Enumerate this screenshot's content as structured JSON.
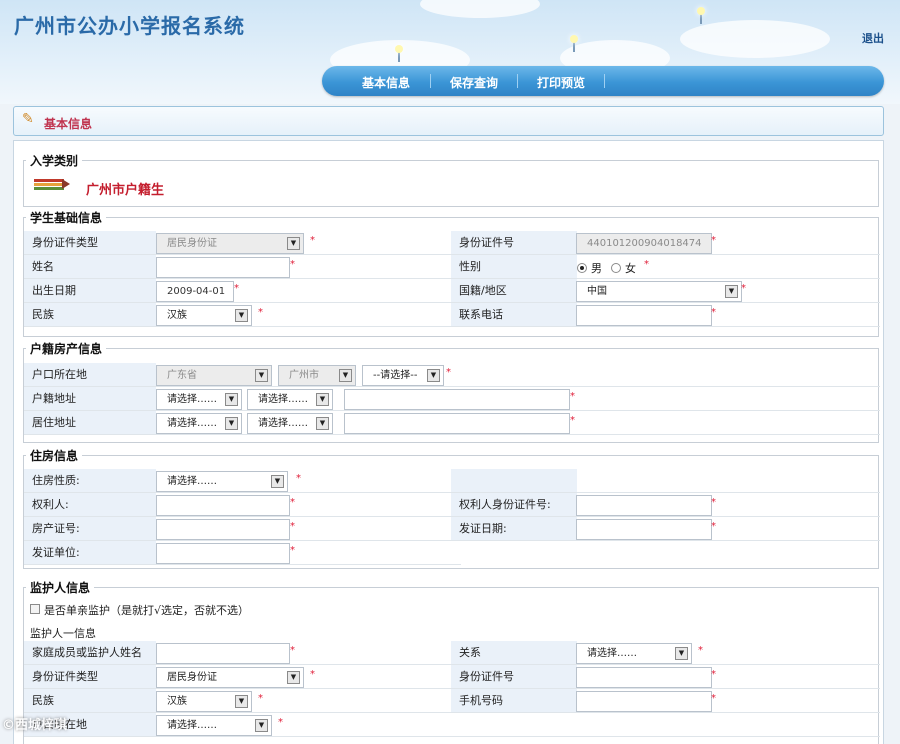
{
  "header": {
    "title": "广州市公办小学报名系统",
    "logout_label": "退出"
  },
  "nav": {
    "items": [
      "基本信息",
      "保存查询",
      "打印预览"
    ]
  },
  "section_bar": {
    "label": "基本信息"
  },
  "enroll_type": {
    "legend": "入学类别",
    "value": "广州市户籍生"
  },
  "student": {
    "legend": "学生基础信息",
    "id_type_label": "身份证件类型",
    "id_type_value": "居民身份证",
    "id_no_label": "身份证件号",
    "id_no_value": "440101200904018474",
    "name_label": "姓名",
    "gender_label": "性别",
    "gender_male": "男",
    "gender_female": "女",
    "birth_label": "出生日期",
    "birth_value": "2009-04-01",
    "nation_label": "国籍/地区",
    "nation_value": "中国",
    "ethnic_label": "民族",
    "ethnic_value": "汉族",
    "phone_label": "联系电话"
  },
  "hukou": {
    "legend": "户籍房产信息",
    "location_label": "户口所在地",
    "province": "广东省",
    "city": "广州市",
    "district": "--请选择--",
    "hukou_addr_label": "户籍地址",
    "residence_addr_label": "居住地址",
    "select_placeholder": "请选择……"
  },
  "housing": {
    "legend": "住房信息",
    "nature_label": "住房性质:",
    "nature_value": "请选择……",
    "owner_label": "权利人:",
    "owner_id_label": "权利人身份证件号:",
    "cert_no_label": "房产证号:",
    "issue_date_label": "发证日期:",
    "issuer_label": "发证单位:"
  },
  "guardian": {
    "legend": "监护人信息",
    "single_parent_label": "是否单亲监护（是就打√选定，否就不选）",
    "first_label": "监护人一信息",
    "member_name_label": "家庭成员或监护人姓名",
    "relation_label": "关系",
    "relation_value": "请选择……",
    "id_type_label": "身份证件类型",
    "id_type_value": "居民身份证",
    "id_no_label": "身份证件号",
    "ethnic_label": "民族",
    "ethnic_value": "汉族",
    "mobile_label": "手机号码",
    "hukou_label": "户口所在地",
    "hukou_value": "请选择……"
  },
  "watermark": "©西城梓琪",
  "required_mark": "*",
  "colors": {
    "accent_blue": "#3b95d6",
    "title_blue": "#2a6aa8",
    "required_red": "#e0203a",
    "hukou_red": "#c41e2e"
  }
}
